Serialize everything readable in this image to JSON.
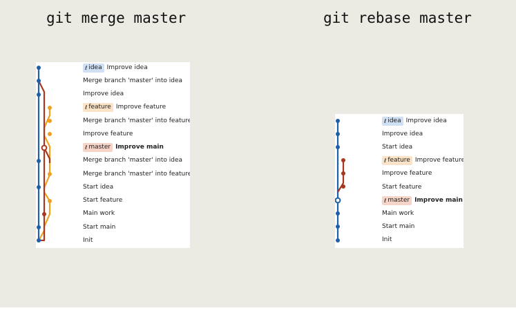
{
  "colors": {
    "background": "#ebeae3",
    "panel": "#ffffff",
    "blue_line": "#1f5fa8",
    "red_line": "#a8371d",
    "orange_line": "#f0a020",
    "badge_idea": "#cfe0f5",
    "badge_feature": "#fbe3c8",
    "badge_master": "#f7d4c8"
  },
  "branch_icon": "git-branch-icon",
  "merge_panel": {
    "title": "git merge master",
    "rows": [
      {
        "badge": "idea",
        "badge_style": "idea",
        "message": "Improve idea",
        "bold": false
      },
      {
        "badge": "",
        "badge_style": "",
        "message": "Merge branch 'master' into idea",
        "bold": false
      },
      {
        "badge": "",
        "badge_style": "",
        "message": "Improve idea",
        "bold": false
      },
      {
        "badge": "feature",
        "badge_style": "feature",
        "message": "Improve feature",
        "bold": false
      },
      {
        "badge": "",
        "badge_style": "",
        "message": "Merge branch 'master' into feature",
        "bold": false
      },
      {
        "badge": "",
        "badge_style": "",
        "message": "Improve feature",
        "bold": false
      },
      {
        "badge": "master",
        "badge_style": "master",
        "message": "Improve main",
        "bold": true
      },
      {
        "badge": "",
        "badge_style": "",
        "message": "Merge branch 'master' into idea",
        "bold": false
      },
      {
        "badge": "",
        "badge_style": "",
        "message": "Merge branch 'master' into feature",
        "bold": false
      },
      {
        "badge": "",
        "badge_style": "",
        "message": "Start idea",
        "bold": false
      },
      {
        "badge": "",
        "badge_style": "",
        "message": "Start feature",
        "bold": false
      },
      {
        "badge": "",
        "badge_style": "",
        "message": "Main work",
        "bold": false
      },
      {
        "badge": "",
        "badge_style": "",
        "message": "Start main",
        "bold": false
      },
      {
        "badge": "",
        "badge_style": "",
        "message": "Init",
        "bold": false
      }
    ]
  },
  "rebase_panel": {
    "title": "git rebase master",
    "rows": [
      {
        "badge": "idea",
        "badge_style": "idea",
        "message": "Improve idea",
        "bold": false
      },
      {
        "badge": "",
        "badge_style": "",
        "message": "Improve idea",
        "bold": false
      },
      {
        "badge": "",
        "badge_style": "",
        "message": "Start idea",
        "bold": false
      },
      {
        "badge": "feature",
        "badge_style": "feature",
        "message": "Improve feature",
        "bold": false
      },
      {
        "badge": "",
        "badge_style": "",
        "message": "Improve feature",
        "bold": false
      },
      {
        "badge": "",
        "badge_style": "",
        "message": "Start feature",
        "bold": false
      },
      {
        "badge": "master",
        "badge_style": "master",
        "message": "Improve main",
        "bold": true
      },
      {
        "badge": "",
        "badge_style": "",
        "message": "Main work",
        "bold": false
      },
      {
        "badge": "",
        "badge_style": "",
        "message": "Start main",
        "bold": false
      },
      {
        "badge": "",
        "badge_style": "",
        "message": "Init",
        "bold": false
      }
    ]
  }
}
